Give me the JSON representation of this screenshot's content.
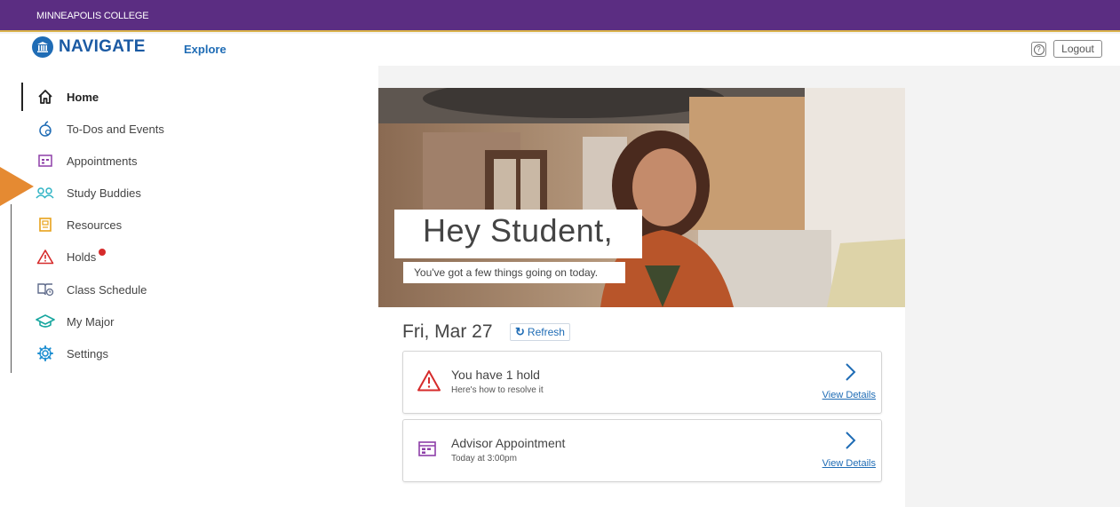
{
  "topbar": {
    "college_name": "MINNEAPOLIS COLLEGE"
  },
  "header": {
    "logo_text": "NAVIGATE",
    "explore_label": "Explore",
    "help_label": "?",
    "logout_label": "Logout"
  },
  "sidebar": {
    "items": [
      {
        "label": "Home",
        "icon": "home-icon"
      },
      {
        "label": "To-Dos and Events",
        "icon": "apple-icon"
      },
      {
        "label": "Appointments",
        "icon": "calendar-icon"
      },
      {
        "label": "Study Buddies",
        "icon": "people-icon"
      },
      {
        "label": "Resources",
        "icon": "book-icon"
      },
      {
        "label": "Holds",
        "icon": "warning-icon"
      },
      {
        "label": "Class Schedule",
        "icon": "schedule-icon"
      },
      {
        "label": "My Major",
        "icon": "graduation-cap-icon"
      },
      {
        "label": "Settings",
        "icon": "gear-icon"
      }
    ]
  },
  "hero": {
    "greeting": "Hey Student,",
    "subtitle": "You've got a few things going on today."
  },
  "today": {
    "date": "Fri, Mar 27",
    "refresh_label": "Refresh"
  },
  "cards": [
    {
      "title": "You have 1 hold",
      "subtitle": "Here's how to resolve it",
      "link": "View Details",
      "icon": "warning-icon"
    },
    {
      "title": "Advisor Appointment",
      "subtitle": "Today at 3:00pm",
      "link": "View Details",
      "icon": "calendar-icon"
    }
  ],
  "colors": {
    "brand_purple": "#5b2d82",
    "accent_gold": "#d9b24a",
    "link_blue": "#1f6cb5",
    "alert_red": "#d62b2b",
    "callout_orange": "#e58a32"
  }
}
